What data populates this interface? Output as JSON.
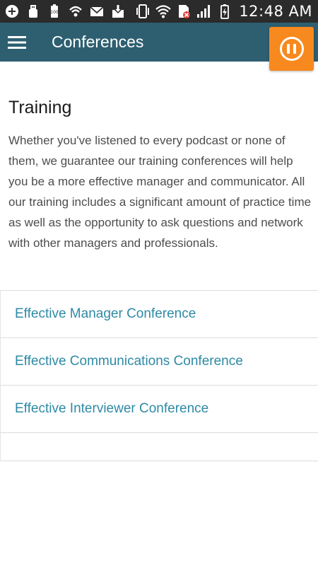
{
  "status_bar": {
    "time": "12:48 AM",
    "icons": [
      "add-icon",
      "usb-icon",
      "battery-saver-icon",
      "hotspot-icon",
      "email-icon",
      "download-icon",
      "vibrate-icon",
      "wifi-icon",
      "no-sim-icon",
      "signal-icon",
      "battery-charging-icon"
    ]
  },
  "app_bar": {
    "title": "Conferences",
    "menu_icon": "menu-icon",
    "pause_icon": "pause-icon",
    "bar_color": "#2d5f70",
    "pause_color": "#f7891f"
  },
  "content": {
    "heading": "Training",
    "intro": "Whether you've listened to every podcast or none of them, we guarantee our training conferences will help you be a more effective manager and communicator. All our training includes a significant  amount of practice time as well as the opportunity to ask questions and network with other managers and professionals.",
    "conferences": [
      {
        "label": "Effective Manager Conference"
      },
      {
        "label": "Effective Communications Conference"
      },
      {
        "label": "Effective Interviewer Conference"
      }
    ],
    "link_color": "#2e8aa5"
  }
}
